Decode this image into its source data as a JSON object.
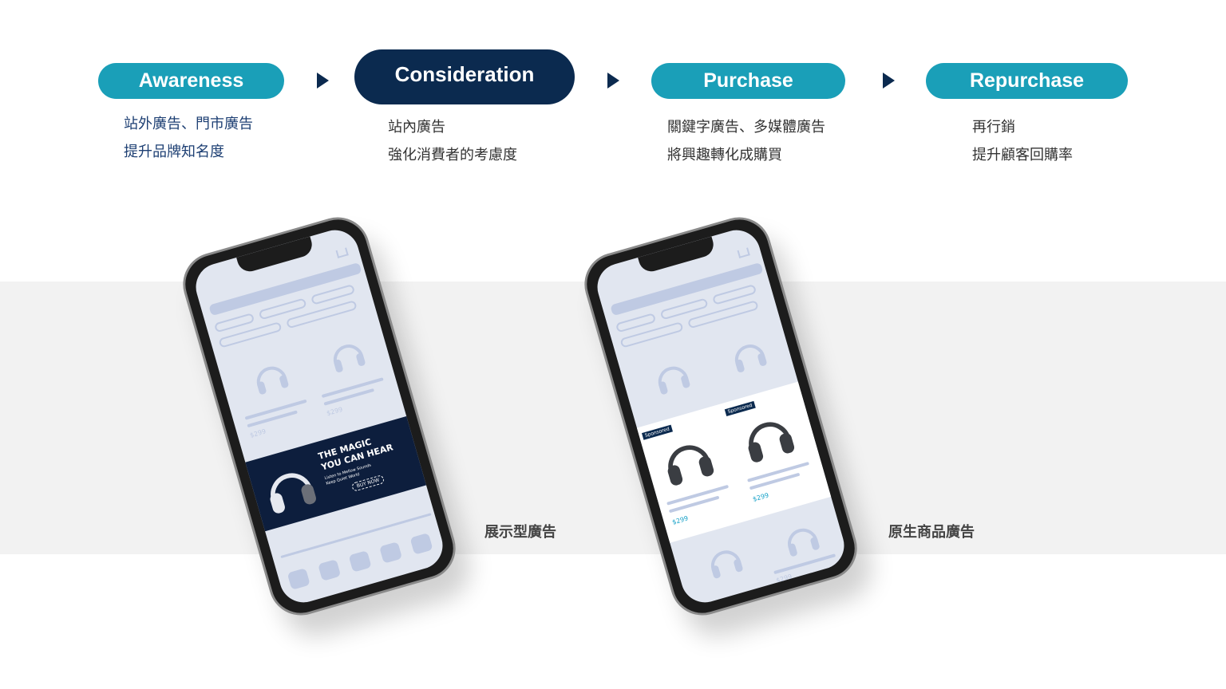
{
  "colors": {
    "stage": "#1a9fb8",
    "active_stage": "#0b2a4f",
    "arrow": "#0b2a4f",
    "band": "#f2f2f2"
  },
  "stages": [
    {
      "label": "Awareness",
      "lines": [
        "站外廣告、門市廣告",
        "提升品牌知名度"
      ]
    },
    {
      "label": "Consideration",
      "lines": [
        "站內廣告",
        "強化消費者的考慮度"
      ]
    },
    {
      "label": "Purchase",
      "lines": [
        "關鍵字廣告、多媒體廣告",
        "將興趣轉化成購買"
      ]
    },
    {
      "label": "Repurchase",
      "lines": [
        "再行銷",
        "提升顧客回購率"
      ]
    }
  ],
  "phones": [
    {
      "caption": "展示型廣告",
      "price": "$299",
      "banner": {
        "title1": "THE MAGIC",
        "title2": "YOU CAN HEAR",
        "sub1": "Listen to Mellow Sounds",
        "sub2": "Keep Quiet World",
        "cta": "BUY NOW"
      }
    },
    {
      "caption": "原生商品廣告",
      "price": "$299",
      "sponsored": "Sponsored"
    }
  ]
}
